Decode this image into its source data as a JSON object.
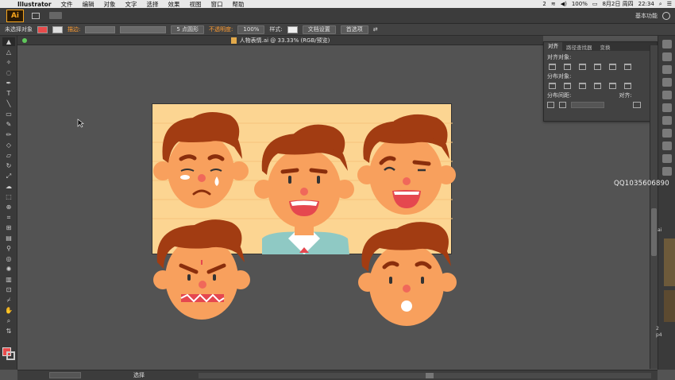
{
  "mac_menubar": {
    "app_name": "Illustrator",
    "menus": [
      "文件",
      "编辑",
      "对象",
      "文字",
      "选择",
      "效果",
      "视图",
      "窗口",
      "帮助"
    ],
    "status": {
      "badge": "2",
      "battery": "100%",
      "date": "8月2日 周四",
      "time": "22:34"
    }
  },
  "app_bar": {
    "logo": "Ai",
    "workspace": "基本功能"
  },
  "control_bar": {
    "selection_state": "未选择对象",
    "stroke_label": "描边:",
    "brush": "5 点圆形",
    "opacity_label": "不透明度:",
    "opacity_value": "100%",
    "style_label": "样式:",
    "doc_setup_button": "文档设置",
    "preferences_button": "首选项",
    "fill_color": "#e84b4b"
  },
  "document": {
    "tab_title": "人物表情.ai @ 33.33% (RGB/预览)"
  },
  "align_panel": {
    "tabs": [
      "对齐",
      "路径查找器",
      "变换"
    ],
    "active_tab": "对齐",
    "align_objects_label": "对齐对象:",
    "distribute_objects_label": "分布对象:",
    "distribute_spacing_label": "分布间距:",
    "align_to_label": "对齐:"
  },
  "status_bar": {
    "tool_state": "选择"
  },
  "watermark": "QQ1035606890",
  "side_cut_text": {
    "a": "ai",
    "b": "2",
    "c": "p4"
  },
  "colors": {
    "artboard_bg": "#fcd592",
    "skin": "#f8a05d",
    "hair": "#a23c12",
    "nose": "#f0685a",
    "mouth": "#e5474f",
    "brow": "#8a2e0c"
  }
}
